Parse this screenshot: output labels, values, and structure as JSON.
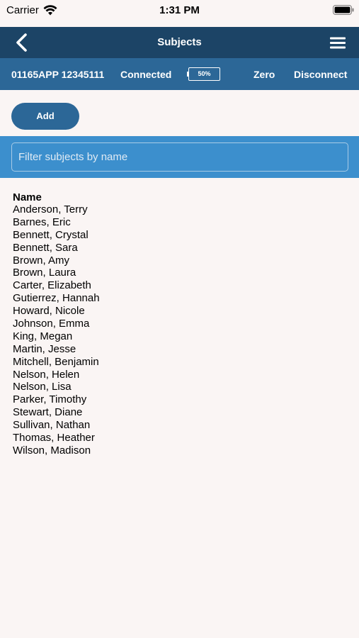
{
  "status_bar": {
    "carrier": "Carrier",
    "time": "1:31 PM"
  },
  "navbar": {
    "title": "Subjects"
  },
  "device": {
    "id": "01165APP 12345111",
    "status": "Connected",
    "battery_label": "50%",
    "zero_label": "Zero",
    "disconnect_label": "Disconnect"
  },
  "actions": {
    "add_label": "Add"
  },
  "filter": {
    "placeholder": "Filter subjects by name",
    "value": ""
  },
  "subjects": {
    "header": "Name",
    "items": [
      "Anderson, Terry",
      "Barnes, Eric",
      "Bennett, Crystal",
      "Bennett, Sara",
      "Brown, Amy",
      "Brown, Laura",
      "Carter, Elizabeth",
      "Gutierrez, Hannah",
      "Howard, Nicole",
      "Johnson, Emma",
      "King, Megan",
      "Martin, Jesse",
      "Mitchell, Benjamin",
      "Nelson, Helen",
      "Nelson, Lisa",
      "Parker, Timothy",
      "Stewart, Diane",
      "Sullivan, Nathan",
      "Thomas, Heather",
      "Wilson, Madison"
    ]
  },
  "colors": {
    "navbar_bg": "#1c4466",
    "devicebar_bg": "#2c6797",
    "filter_band_bg": "#3c8fcd",
    "page_bg": "#faf5f4"
  },
  "icons": {
    "wifi": "wifi-icon",
    "battery": "battery-icon",
    "back": "chevron-left-icon",
    "menu": "hamburger-menu-icon",
    "device_battery": "battery-level-icon"
  }
}
